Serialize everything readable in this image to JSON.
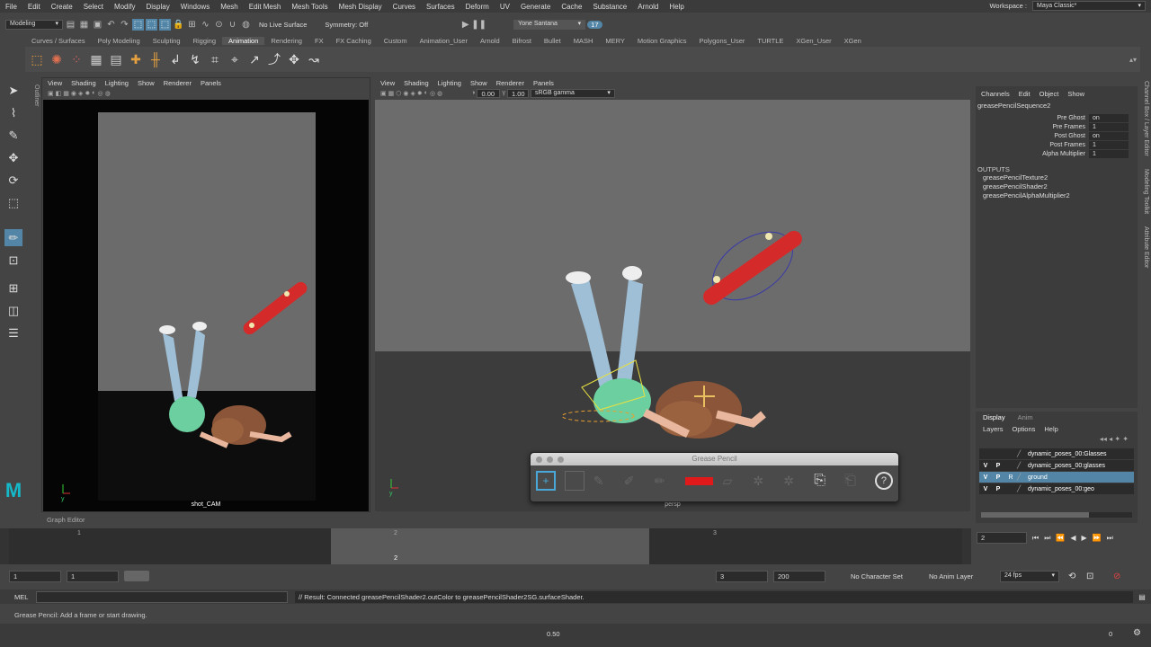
{
  "menu": [
    "File",
    "Edit",
    "Create",
    "Select",
    "Modify",
    "Display",
    "Windows",
    "Mesh",
    "Edit Mesh",
    "Mesh Tools",
    "Mesh Display",
    "Curves",
    "Surfaces",
    "Deform",
    "UV",
    "Generate",
    "Cache",
    "Substance",
    "Arnold",
    "Help"
  ],
  "workspace": {
    "label": "Workspace :",
    "value": "Maya Classic*"
  },
  "status": {
    "mode": "Modeling",
    "no_live": "No Live Surface",
    "symmetry": "Symmetry: Off",
    "user": "Yone Santana",
    "notifications": "17"
  },
  "shelf_tabs": [
    "Curves / Surfaces",
    "Poly Modeling",
    "Sculpting",
    "Rigging",
    "Animation",
    "Rendering",
    "FX",
    "FX Caching",
    "Custom",
    "Animation_User",
    "Arnold",
    "Bifrost",
    "Bullet",
    "MASH",
    "MERY",
    "Motion Graphics",
    "Polygons_User",
    "TURTLE",
    "XGen_User",
    "XGen"
  ],
  "shelf_active": "Animation",
  "outliner_label": "Outliner",
  "panel_menu": [
    "View",
    "Shading",
    "Lighting",
    "Show",
    "Renderer",
    "Panels"
  ],
  "left_view": {
    "camera": "shot_CAM"
  },
  "right_view": {
    "camera": "persp",
    "val1": "0.00",
    "val2": "1.00",
    "colorspace": "sRGB gamma"
  },
  "channelbox": {
    "menu": [
      "Channels",
      "Edit",
      "Object",
      "Show"
    ],
    "node": "greasePencilSequence2",
    "attrs": [
      {
        "name": "Pre Ghost",
        "value": "on"
      },
      {
        "name": "Pre Frames",
        "value": "1"
      },
      {
        "name": "Post Ghost",
        "value": "on"
      },
      {
        "name": "Post Frames",
        "value": "1"
      },
      {
        "name": "Alpha Multiplier",
        "value": "1"
      }
    ],
    "outputs_label": "OUTPUTS",
    "outputs": [
      "greasePencilTexture2",
      "greasePencilShader2",
      "greasePencilAlphaMultiplier2"
    ]
  },
  "side_tabs": [
    "Channel Box / Layer Editor",
    "Modeling Toolkit",
    "Attribute Editor"
  ],
  "layers": {
    "tabs": [
      "Display",
      "Anim"
    ],
    "menu": [
      "Layers",
      "Options",
      "Help"
    ],
    "items": [
      {
        "v": "",
        "p": "",
        "name": "dynamic_poses_00:Glasses",
        "selected": false
      },
      {
        "v": "V",
        "p": "P",
        "name": "dynamic_poses_00:glasses",
        "selected": false
      },
      {
        "v": "V",
        "p": "P",
        "r": "R",
        "name": "ground",
        "selected": true
      },
      {
        "v": "V",
        "p": "P",
        "name": "dynamic_poses_00:geo",
        "selected": false
      }
    ]
  },
  "graph_editor": "Graph Editor",
  "timeline": {
    "ticks": [
      "1",
      "2",
      "3"
    ],
    "current": "2",
    "current_field": "2"
  },
  "range": {
    "start": "1",
    "start2": "1",
    "end1": "3",
    "end2": "200",
    "char_set": "No Character Set",
    "anim_layer": "No Anim Layer",
    "fps": "24 fps"
  },
  "mel": {
    "label": "MEL",
    "result": "// Result: Connected greasePencilShader2.outColor to greasePencilShader2SG.surfaceShader."
  },
  "help_line": "Grease Pencil: Add a frame or start drawing.",
  "grease_pencil": {
    "title": "Grease Pencil",
    "brush_color": "#e01a1a"
  },
  "bottom": {
    "value": "0.50",
    "zero": "0"
  },
  "colors": {
    "accent": "#5285a6",
    "skateboard": "#d42a2a"
  }
}
